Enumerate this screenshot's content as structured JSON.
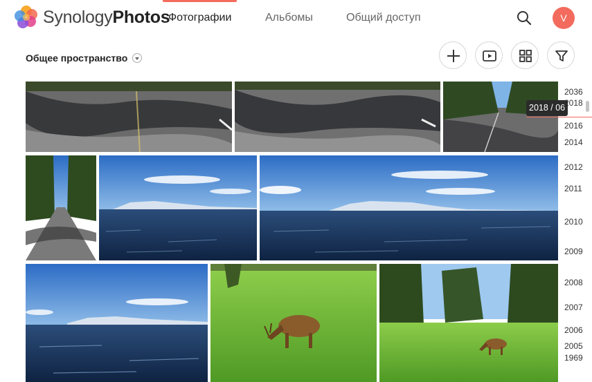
{
  "app": {
    "brand_light": "Synology",
    "brand_bold": "Photos",
    "accent_color": "#f36b5d"
  },
  "nav": {
    "tabs": [
      {
        "label": "Фотографии",
        "active": true
      },
      {
        "label": "Альбомы",
        "active": false
      },
      {
        "label": "Общий доступ",
        "active": false
      }
    ]
  },
  "header": {
    "search_icon": "search-icon",
    "avatar_letter": "V"
  },
  "toolbar": {
    "space_title": "Общее пространство",
    "buttons": [
      "plus-icon",
      "slideshow-icon",
      "grid-view-icon",
      "filter-icon"
    ]
  },
  "photos": [
    {
      "subject": "road-shadows"
    },
    {
      "subject": "road-shadows"
    },
    {
      "subject": "road-forest"
    },
    {
      "subject": "road-forest-vertical"
    },
    {
      "subject": "lake-mountains"
    },
    {
      "subject": "lake-mountains-wide"
    },
    {
      "subject": "lake-waves"
    },
    {
      "subject": "elk-meadow"
    },
    {
      "subject": "elk-forest-meadow"
    }
  ],
  "timeline": {
    "current": "2018 / 06",
    "years": [
      "2036",
      "2018",
      "2016",
      "2014",
      "2012",
      "2011",
      "2010",
      "2009",
      "2008",
      "2007",
      "2006",
      "2005",
      "1969"
    ]
  }
}
